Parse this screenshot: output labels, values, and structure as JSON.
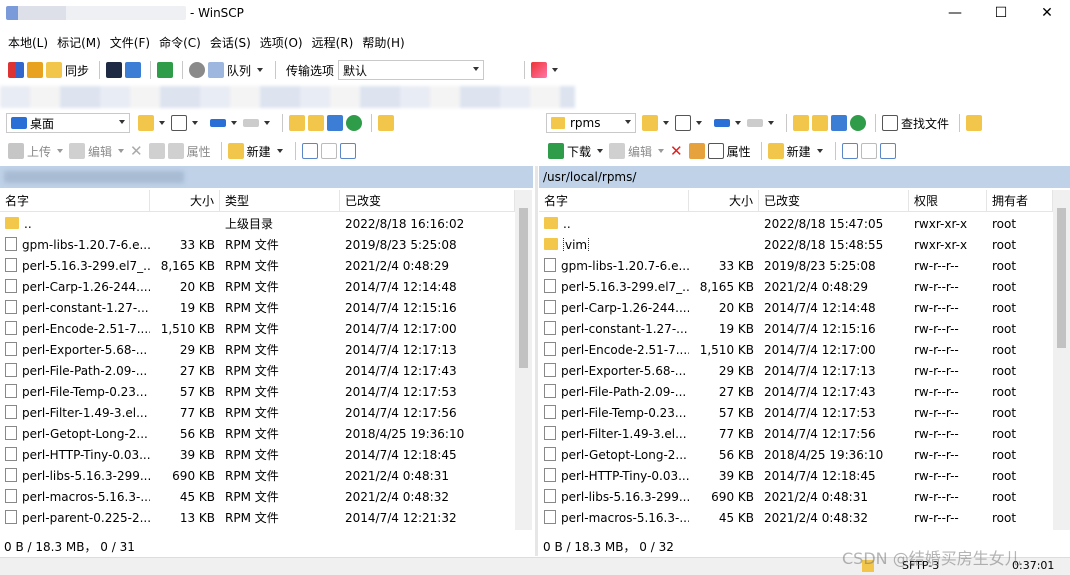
{
  "window": {
    "title": "- WinSCP",
    "buttons": [
      "—",
      "☐",
      "✕"
    ]
  },
  "menu": [
    "本地(L)",
    "标记(M)",
    "文件(F)",
    "命令(C)",
    "会话(S)",
    "选项(O)",
    "远程(R)",
    "帮助(H)"
  ],
  "toolbar1": {
    "sync": "同步",
    "queue": "队列",
    "transfer_label": "传输选项",
    "transfer_value": "默认"
  },
  "left": {
    "location": "桌面",
    "upload": "上传",
    "edit": "编辑",
    "props": "属性",
    "new": "新建",
    "path": "",
    "columns": [
      "名字",
      "大小",
      "类型",
      "已改变"
    ],
    "rows": [
      {
        "name": "..",
        "size": "",
        "type": "上级目录",
        "changed": "2022/8/18  16:16:02",
        "kind": "up"
      },
      {
        "name": "gpm-libs-1.20.7-6.e...",
        "size": "33 KB",
        "type": "RPM 文件",
        "changed": "2019/8/23  5:25:08",
        "kind": "file"
      },
      {
        "name": "perl-5.16.3-299.el7_...",
        "size": "8,165 KB",
        "type": "RPM 文件",
        "changed": "2021/2/4  0:48:29",
        "kind": "file"
      },
      {
        "name": "perl-Carp-1.26-244....",
        "size": "20 KB",
        "type": "RPM 文件",
        "changed": "2014/7/4  12:14:48",
        "kind": "file"
      },
      {
        "name": "perl-constant-1.27-...",
        "size": "19 KB",
        "type": "RPM 文件",
        "changed": "2014/7/4  12:15:16",
        "kind": "file"
      },
      {
        "name": "perl-Encode-2.51-7....",
        "size": "1,510 KB",
        "type": "RPM 文件",
        "changed": "2014/7/4  12:17:00",
        "kind": "file"
      },
      {
        "name": "perl-Exporter-5.68-...",
        "size": "29 KB",
        "type": "RPM 文件",
        "changed": "2014/7/4  12:17:13",
        "kind": "file"
      },
      {
        "name": "perl-File-Path-2.09-...",
        "size": "27 KB",
        "type": "RPM 文件",
        "changed": "2014/7/4  12:17:43",
        "kind": "file"
      },
      {
        "name": "perl-File-Temp-0.23...",
        "size": "57 KB",
        "type": "RPM 文件",
        "changed": "2014/7/4  12:17:53",
        "kind": "file"
      },
      {
        "name": "perl-Filter-1.49-3.el...",
        "size": "77 KB",
        "type": "RPM 文件",
        "changed": "2014/7/4  12:17:56",
        "kind": "file"
      },
      {
        "name": "perl-Getopt-Long-2...",
        "size": "56 KB",
        "type": "RPM 文件",
        "changed": "2018/4/25  19:36:10",
        "kind": "file"
      },
      {
        "name": "perl-HTTP-Tiny-0.03...",
        "size": "39 KB",
        "type": "RPM 文件",
        "changed": "2014/7/4  12:18:45",
        "kind": "file"
      },
      {
        "name": "perl-libs-5.16.3-299...",
        "size": "690 KB",
        "type": "RPM 文件",
        "changed": "2021/2/4  0:48:31",
        "kind": "file"
      },
      {
        "name": "perl-macros-5.16.3-...",
        "size": "45 KB",
        "type": "RPM 文件",
        "changed": "2021/2/4  0:48:32",
        "kind": "file"
      },
      {
        "name": "perl-parent-0.225-2...",
        "size": "13 KB",
        "type": "RPM 文件",
        "changed": "2014/7/4  12:21:32",
        "kind": "file"
      }
    ],
    "status": "0 B / 18.3 MB，  0 / 31"
  },
  "right": {
    "location": "rpms",
    "download": "下载",
    "edit": "编辑",
    "props": "属性",
    "new": "新建",
    "find": "查找文件",
    "path": "/usr/local/rpms/",
    "columns": [
      "名字",
      "大小",
      "已改变",
      "权限",
      "拥有者"
    ],
    "rows": [
      {
        "name": "..",
        "size": "",
        "changed": "2022/8/18 15:47:05",
        "perm": "rwxr-xr-x",
        "owner": "root",
        "kind": "up"
      },
      {
        "name": "vim",
        "size": "",
        "changed": "2022/8/18 15:48:55",
        "perm": "rwxr-xr-x",
        "owner": "root",
        "kind": "folder"
      },
      {
        "name": "gpm-libs-1.20.7-6.e...",
        "size": "33 KB",
        "changed": "2019/8/23 5:25:08",
        "perm": "rw-r--r--",
        "owner": "root",
        "kind": "file"
      },
      {
        "name": "perl-5.16.3-299.el7_...",
        "size": "8,165 KB",
        "changed": "2021/2/4 0:48:29",
        "perm": "rw-r--r--",
        "owner": "root",
        "kind": "file"
      },
      {
        "name": "perl-Carp-1.26-244....",
        "size": "20 KB",
        "changed": "2014/7/4 12:14:48",
        "perm": "rw-r--r--",
        "owner": "root",
        "kind": "file"
      },
      {
        "name": "perl-constant-1.27-...",
        "size": "19 KB",
        "changed": "2014/7/4 12:15:16",
        "perm": "rw-r--r--",
        "owner": "root",
        "kind": "file"
      },
      {
        "name": "perl-Encode-2.51-7....",
        "size": "1,510 KB",
        "changed": "2014/7/4 12:17:00",
        "perm": "rw-r--r--",
        "owner": "root",
        "kind": "file"
      },
      {
        "name": "perl-Exporter-5.68-...",
        "size": "29 KB",
        "changed": "2014/7/4 12:17:13",
        "perm": "rw-r--r--",
        "owner": "root",
        "kind": "file"
      },
      {
        "name": "perl-File-Path-2.09-...",
        "size": "27 KB",
        "changed": "2014/7/4 12:17:43",
        "perm": "rw-r--r--",
        "owner": "root",
        "kind": "file"
      },
      {
        "name": "perl-File-Temp-0.23...",
        "size": "57 KB",
        "changed": "2014/7/4 12:17:53",
        "perm": "rw-r--r--",
        "owner": "root",
        "kind": "file"
      },
      {
        "name": "perl-Filter-1.49-3.el...",
        "size": "77 KB",
        "changed": "2014/7/4 12:17:56",
        "perm": "rw-r--r--",
        "owner": "root",
        "kind": "file"
      },
      {
        "name": "perl-Getopt-Long-2...",
        "size": "56 KB",
        "changed": "2018/4/25 19:36:10",
        "perm": "rw-r--r--",
        "owner": "root",
        "kind": "file"
      },
      {
        "name": "perl-HTTP-Tiny-0.03...",
        "size": "39 KB",
        "changed": "2014/7/4 12:18:45",
        "perm": "rw-r--r--",
        "owner": "root",
        "kind": "file"
      },
      {
        "name": "perl-libs-5.16.3-299...",
        "size": "690 KB",
        "changed": "2021/2/4 0:48:31",
        "perm": "rw-r--r--",
        "owner": "root",
        "kind": "file"
      },
      {
        "name": "perl-macros-5.16.3-...",
        "size": "45 KB",
        "changed": "2021/2/4 0:48:32",
        "perm": "rw-r--r--",
        "owner": "root",
        "kind": "file"
      }
    ],
    "status": "0 B / 18.3 MB，  0 / 32"
  },
  "bottom": {
    "protocol": "SFTP-3",
    "time": "0:37:01",
    "watermark": "CSDN @结婚买房生女儿"
  },
  "colors": {
    "path_bg": "#bfd2e8",
    "folder": "#f3c74a",
    "accent": "#2a6fd6"
  }
}
